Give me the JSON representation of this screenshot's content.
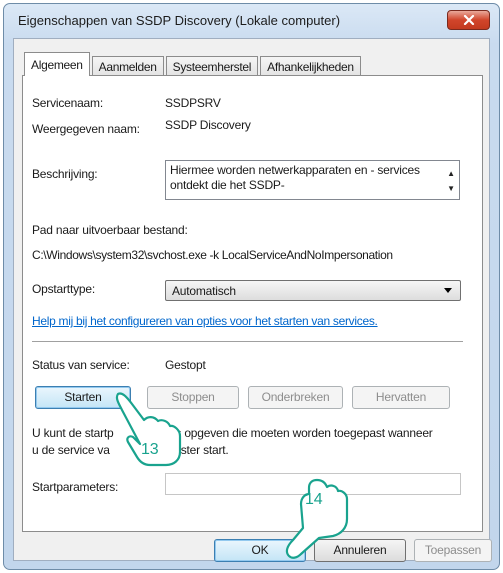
{
  "window": {
    "title": "Eigenschappen van SSDP Discovery  (Lokale computer)"
  },
  "tabs": [
    {
      "label": "Algemeen"
    },
    {
      "label": "Aanmelden"
    },
    {
      "label": "Systeemherstel"
    },
    {
      "label": "Afhankelijkheden"
    }
  ],
  "general": {
    "service_name_label": "Servicenaam:",
    "service_name_value": "SSDPSRV",
    "display_name_label": "Weergegeven naam:",
    "display_name_value": "SSDP Discovery",
    "description_label": "Beschrijving:",
    "description_value": "Hiermee worden netwerkapparaten en - services ontdekt die het SSDP-",
    "path_label": "Pad naar uitvoerbaar bestand:",
    "path_value": "C:\\Windows\\system32\\svchost.exe -k LocalServiceAndNoImpersonation",
    "startup_type_label": "Opstarttype:",
    "startup_type_value": "Automatisch",
    "help_link": "Help mij bij het configureren van opties voor het starten van services.",
    "status_label": "Status van service:",
    "status_value": "Gestopt",
    "buttons": {
      "start": "Starten",
      "stop": "Stoppen",
      "pause": "Onderbreken",
      "resume": "Hervatten"
    },
    "params_hint_line1": "U kunt de startp",
    "params_hint_line1b": "ters opgeven die moeten worden toegepast wanneer",
    "params_hint_line2": "u de service va",
    "params_hint_line2b": "venster start.",
    "start_params_label": "Startparameters:",
    "start_params_value": ""
  },
  "footer": {
    "ok": "OK",
    "cancel": "Annuleren",
    "apply": "Toepassen"
  },
  "callouts": [
    {
      "number": "13"
    },
    {
      "number": "14"
    }
  ],
  "colors": {
    "link": "#0066cc",
    "close_button": "#d1452b",
    "callout_green": "#19a38e"
  }
}
